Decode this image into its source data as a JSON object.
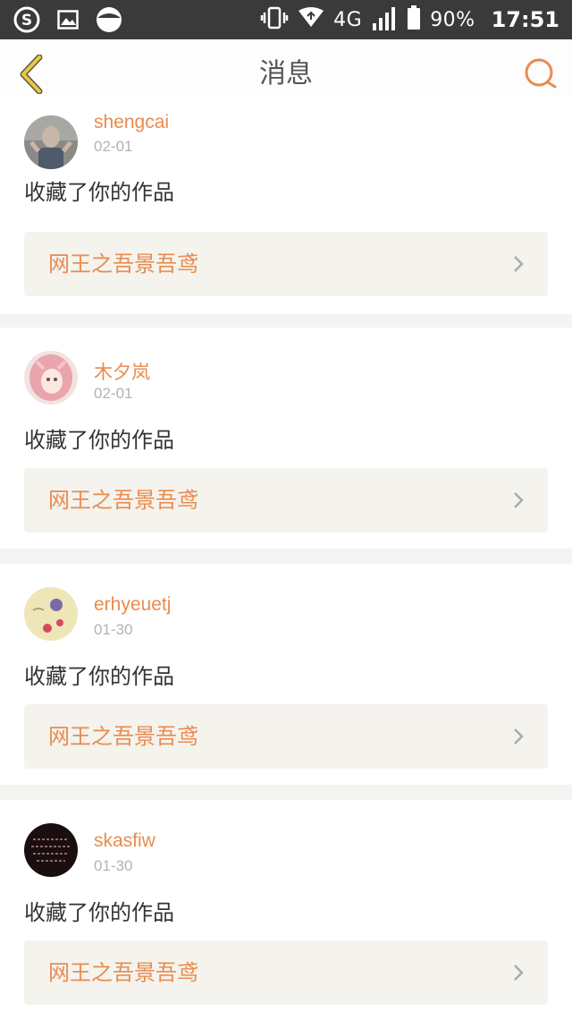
{
  "status_bar": {
    "network": "4G",
    "battery": "90%",
    "time": "17:51"
  },
  "header": {
    "title": "消息"
  },
  "messages": [
    {
      "user": "shengcai",
      "date": "02-01",
      "action": "收藏了你的作品",
      "work": "网王之吾景吾鸢"
    },
    {
      "user": "木夕岚",
      "date": "02-01",
      "action": "收藏了你的作品",
      "work": "网王之吾景吾鸢"
    },
    {
      "user": "erhyeuetj",
      "date": "01-30",
      "action": "收藏了你的作品",
      "work": "网王之吾景吾鸢"
    },
    {
      "user": "skasfiw",
      "date": "01-30",
      "action": "收藏了你的作品",
      "work": "网王之吾景吾鸢"
    }
  ],
  "colors": {
    "accent": "#e98b4f",
    "back_arrow": "#e8c64a"
  }
}
